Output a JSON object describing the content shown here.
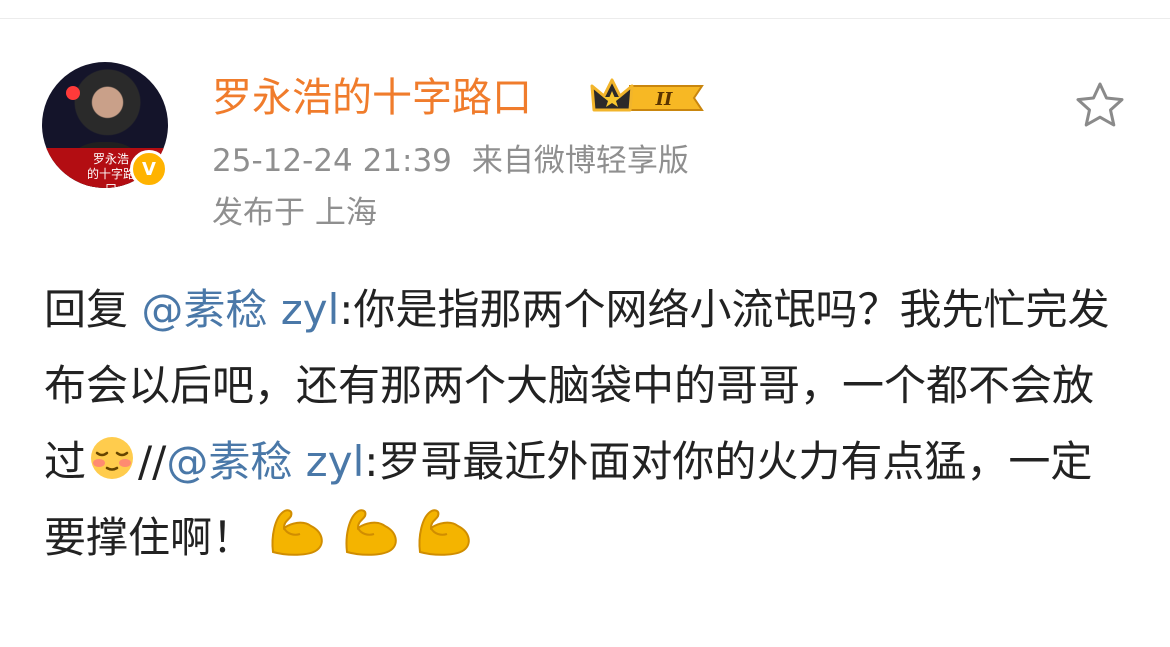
{
  "post": {
    "author": {
      "name": "罗永浩的十字路口",
      "avatar_text_line1": "罗永浩",
      "avatar_text_line2": "的十字路口",
      "verified_label": "V",
      "level_badge_text": "II"
    },
    "timestamp": "25-12-24 21:39",
    "source": "来自微博轻享版",
    "location": "发布于 上海",
    "favorite_icon": "star-outline-icon",
    "content": {
      "reply_prefix": "回复",
      "mention_1": "@素稔 zyl",
      "text_1": ":你是指那两个网络小流氓吗？我先忙完发布会以后吧，还有那两个大脑袋中的哥哥，一个都不会放过",
      "emoji_1": "blushing-face-emoji",
      "forward_sep": "//",
      "mention_2": "@素稔 zyl",
      "text_2": ":罗哥最近外面对你的火力有点猛，一定要撑住啊！",
      "emoji_2": "flexed-biceps-emoji"
    }
  },
  "colors": {
    "username": "#f07c2c",
    "mention": "#4a78a8",
    "meta": "#8f8f8f",
    "body": "#222222",
    "verified": "#ffb300"
  }
}
